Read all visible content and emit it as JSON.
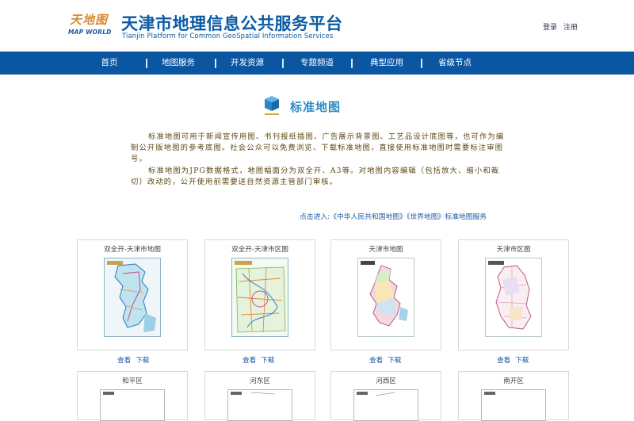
{
  "header": {
    "logo_text_cn": "天地图",
    "logo_text_en": "MAP WORLD",
    "title": "天津市地理信息公共服务平台",
    "subtitle": "Tianjin Platform for Common GeoSpatial Information Services",
    "login": "登录",
    "register": "注册"
  },
  "nav": {
    "items": [
      {
        "label": "首页"
      },
      {
        "label": "地图服务"
      },
      {
        "label": "开发资源"
      },
      {
        "label": "专题频道"
      },
      {
        "label": "典型应用"
      },
      {
        "label": "省级节点"
      }
    ]
  },
  "section": {
    "title": "标准地图",
    "paragraph1": "标准地图可用于新闻宣传用图、书刊报纸插图、广告展示背景图、工艺品设计底图等，也可作为编制公开版地图的参考底图。社会公众可以免费浏览、下载标准地图，直接使用标准地图时需要标注审图号。",
    "paragraph2": "标准地图为JPG数据格式，地图幅面分为双全开、A3等。对地图内容编辑（包括放大、缩小和裁切）改动的，公开使用前需要送自然资源主管部门审核。",
    "link_text": "点击进入:《中华人民共和国地图》《世界地图》标准地图服务"
  },
  "maps": [
    {
      "title": "双全开-天津市地图",
      "view": "查看",
      "download": "下载"
    },
    {
      "title": "双全开-天津市区图",
      "view": "查看",
      "download": "下载"
    },
    {
      "title": "天津市地图",
      "view": "查看",
      "download": "下载"
    },
    {
      "title": "天津市区图",
      "view": "查看",
      "download": "下载"
    },
    {
      "title": "和平区"
    },
    {
      "title": "河东区"
    },
    {
      "title": "河西区"
    },
    {
      "title": "南开区"
    }
  ],
  "colors": {
    "brand_blue": "#0b56a1",
    "title_blue": "#0b5aa4",
    "section_blue": "#2a8ac4",
    "desc_brown": "#5c4712",
    "link_blue": "#1d5aa6",
    "logo_orange": "#d9892a"
  }
}
